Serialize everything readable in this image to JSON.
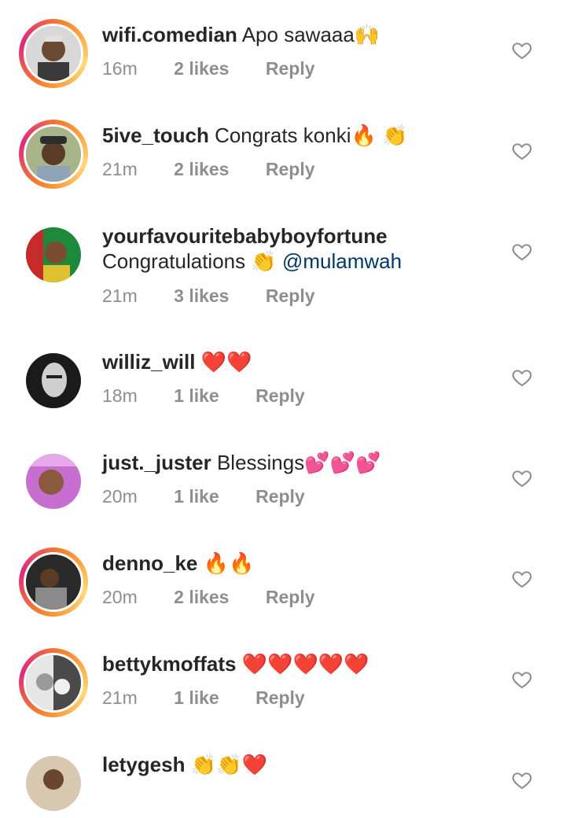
{
  "comments": [
    {
      "username": "wifi.comedian",
      "text": "Apo sawaaa🙌",
      "time": "16m",
      "likes": "2 likes",
      "reply": "Reply"
    },
    {
      "username": "5ive_touch",
      "text": "Congrats konki🔥 👏",
      "time": "21m",
      "likes": "2 likes",
      "reply": "Reply"
    },
    {
      "username": "yourfavouritebabyboyfortune",
      "text": "Congratulations 👏",
      "mention": "@mulamwah",
      "time": "21m",
      "likes": "3 likes",
      "reply": "Reply"
    },
    {
      "username": "williz_will",
      "text": "❤️❤️",
      "time": "18m",
      "likes": "1 like",
      "reply": "Reply"
    },
    {
      "username": "just._juster",
      "text": "Blessings💕💕💕",
      "time": "20m",
      "likes": "1 like",
      "reply": "Reply"
    },
    {
      "username": "denno_ke",
      "text": "🔥🔥",
      "time": "20m",
      "likes": "2 likes",
      "reply": "Reply"
    },
    {
      "username": "bettykmoffats",
      "text": "❤️❤️❤️❤️❤️",
      "time": "21m",
      "likes": "1 like",
      "reply": "Reply"
    },
    {
      "username": "letygesh",
      "text": "👏👏❤️",
      "time": "",
      "likes": "",
      "reply": ""
    }
  ],
  "icons": {
    "like": "heart-outline-icon"
  },
  "colors": {
    "ring_start": "#f58529",
    "ring_mid": "#dd2a7b",
    "mention": "#00376b",
    "meta": "#8e8e8e"
  }
}
